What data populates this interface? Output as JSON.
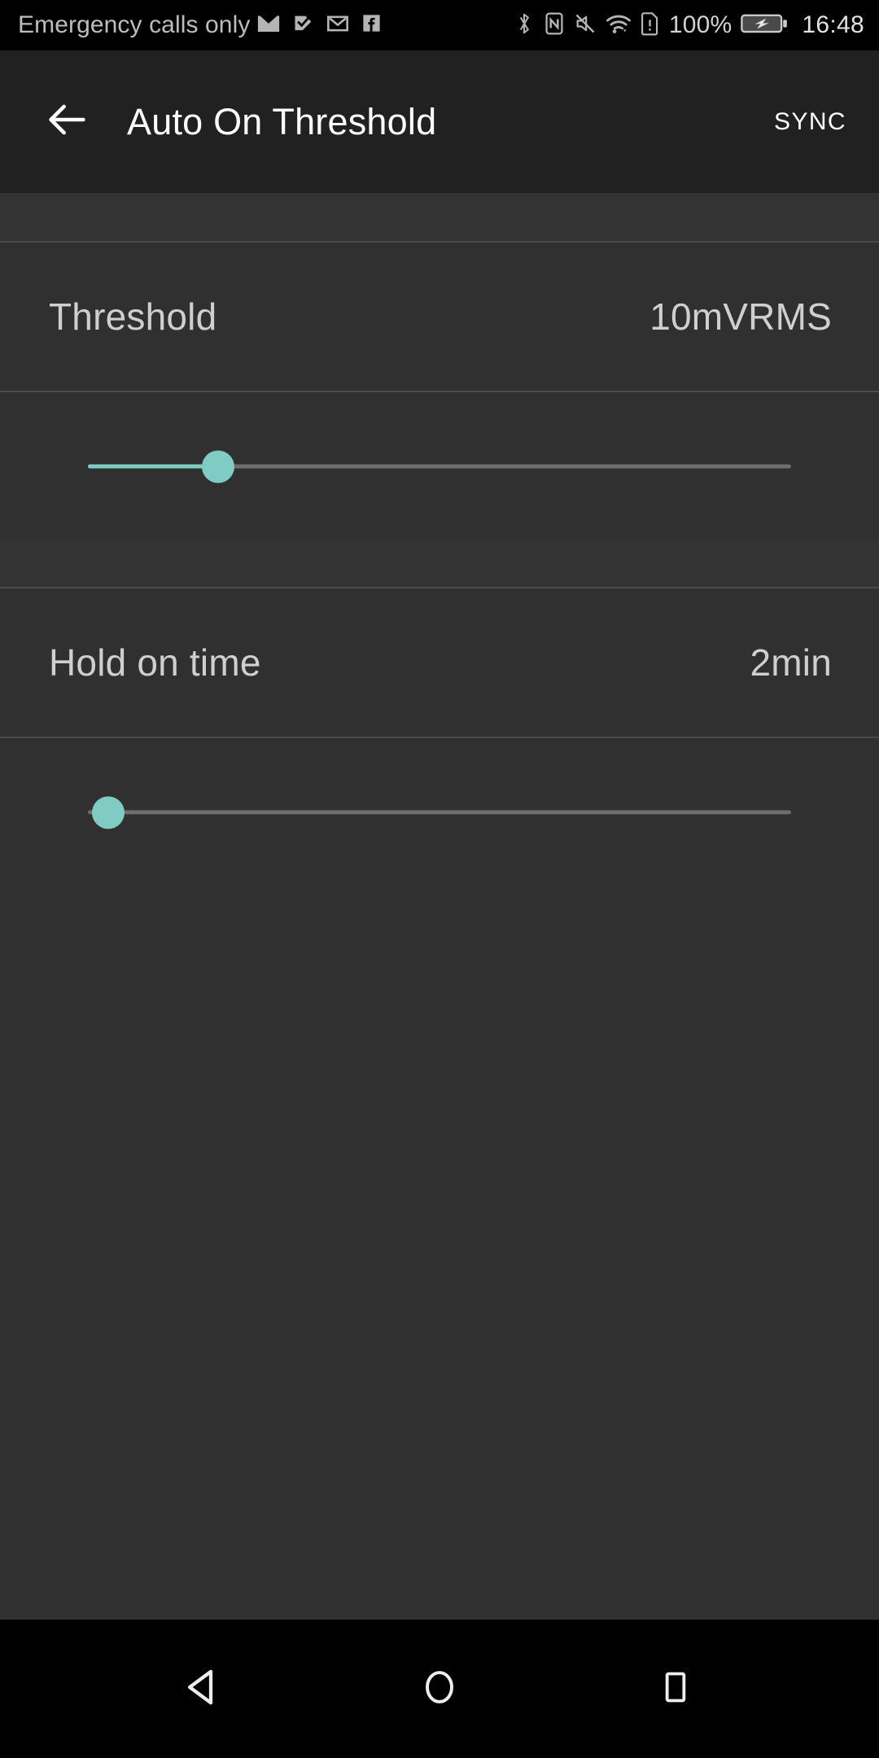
{
  "status_bar": {
    "carrier_text": "Emergency calls only",
    "left_icons": [
      "email-icon",
      "gmail-inbox-icon",
      "gmail-icon",
      "facebook-icon"
    ],
    "right_icons": [
      "bluetooth-icon",
      "nfc-icon",
      "mute-icon",
      "wifi-icon",
      "sim-alert-icon"
    ],
    "battery_percent": "100%",
    "battery_icon": "battery-charging-icon",
    "clock": "16:48"
  },
  "app_bar": {
    "back_icon": "back-arrow-icon",
    "title": "Auto On Threshold",
    "action_label": "SYNC"
  },
  "settings": [
    {
      "label": "Threshold",
      "value": "10mVRMS",
      "slider": {
        "percent": 18.5,
        "filled": true
      }
    },
    {
      "label": "Hold on time",
      "value": "2min",
      "slider": {
        "percent": 2.9,
        "filled": false
      }
    }
  ],
  "nav_bar": {
    "back_icon": "nav-back-triangle-icon",
    "home_icon": "nav-home-circle-icon",
    "recents_icon": "nav-recents-square-icon"
  },
  "colors": {
    "accent": "#80CBC4",
    "background": "#303030",
    "app_bar": "#212121",
    "divider": "#4A4A4A",
    "track": "#6E6E6E",
    "text_primary": "#FFFFFF",
    "text_secondary": "#CFCFCF",
    "status_bar": "#000000"
  }
}
